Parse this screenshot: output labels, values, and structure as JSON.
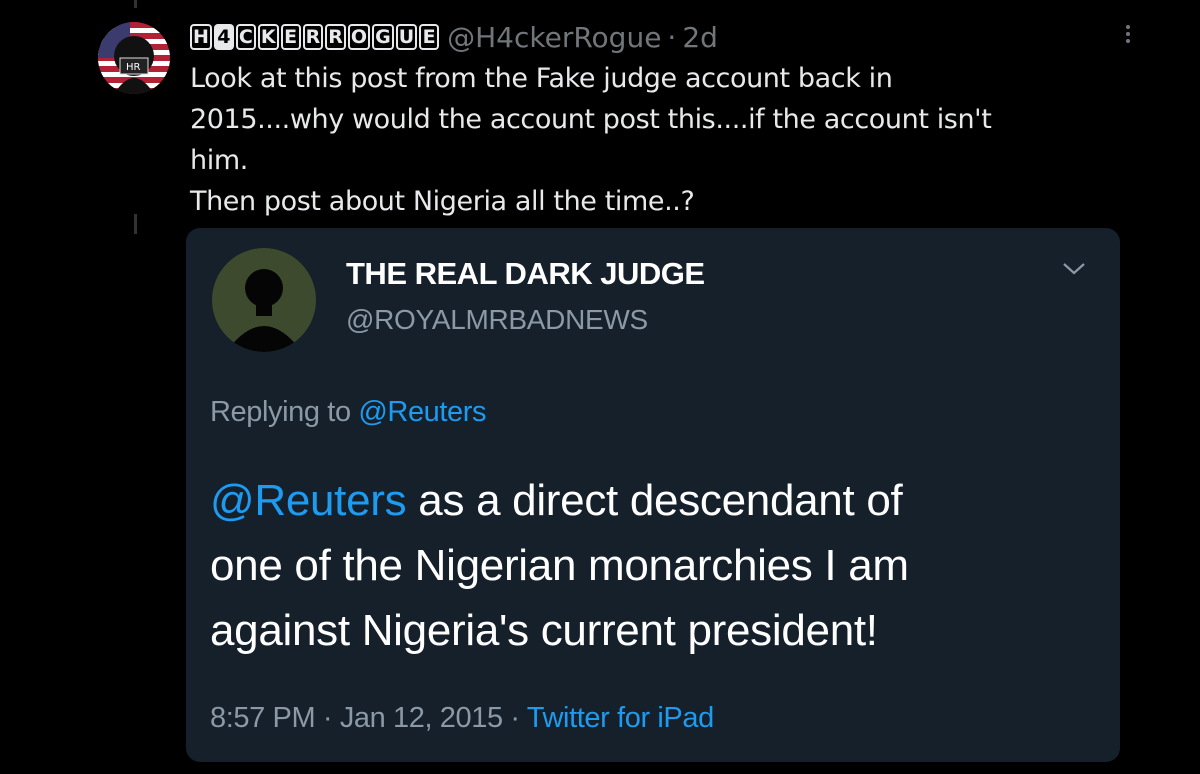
{
  "post": {
    "display_name_letters": [
      "H",
      "4",
      "C",
      "K",
      "E",
      "R",
      "R",
      "O",
      "G",
      "U",
      "E"
    ],
    "handle": "@H4ckerRogue",
    "separator": "·",
    "time": "2d",
    "text_lines": [
      "Look at this post from the Fake judge account back in",
      "2015....why would the account post this....if the account isn't",
      "him.",
      "Then post about Nigeria all the time..?"
    ],
    "avatar_icon": "hacker-flag-avatar",
    "more_icon": "more-dots-icon"
  },
  "quoted": {
    "name": "THE REAL DARK JUDGE",
    "handle": "@ROYALMRBADNEWS",
    "replying_prefix": "Replying to",
    "replying_handle": "@Reuters",
    "mention": "@Reuters",
    "body_line1_rest": " as a direct descendant of",
    "body_line2": "one of the Nigerian monarchies I am",
    "body_line3": "against Nigeria's current president!",
    "time": "8:57 PM",
    "separator": "·",
    "date": "Jan 12, 2015",
    "source": "Twitter for iPad"
  },
  "colors": {
    "background": "#000000",
    "quote_bg": "#15202b",
    "link": "#1d9bf0",
    "muted": "#71767b"
  }
}
